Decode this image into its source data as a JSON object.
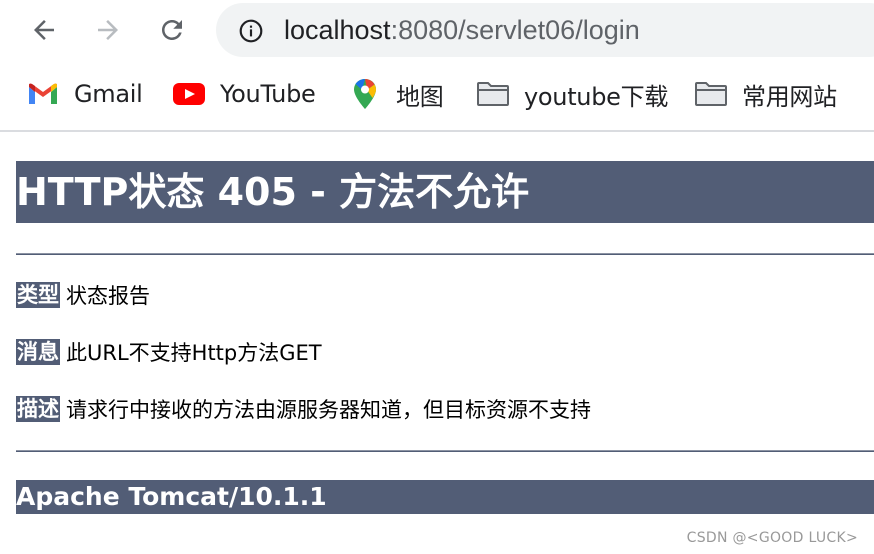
{
  "browser": {
    "url_host": "localhost",
    "url_rest": ":8080/servlet06/login",
    "bookmarks": [
      {
        "label": "Gmail",
        "icon": "gmail-icon"
      },
      {
        "label": "YouTube",
        "icon": "youtube-icon"
      },
      {
        "label": "地图",
        "icon": "maps-icon"
      },
      {
        "label": "youtube下载",
        "icon": "folder-icon"
      },
      {
        "label": "常用网站",
        "icon": "folder-icon"
      }
    ]
  },
  "page": {
    "title": "HTTP状态 405 - 方法不允许",
    "rows": [
      {
        "key": "类型",
        "value": "状态报告"
      },
      {
        "key": "消息",
        "value": "此URL不支持Http方法GET"
      },
      {
        "key": "描述",
        "value": "请求行中接收的方法由源服务器知道，但目标资源不支持"
      }
    ],
    "server": "Apache Tomcat/10.1.1"
  },
  "watermark": "CSDN @<GOOD LUCK>",
  "colors": {
    "tomcat_bar": "#525d76",
    "omnibox_bg": "#f1f3f4"
  }
}
